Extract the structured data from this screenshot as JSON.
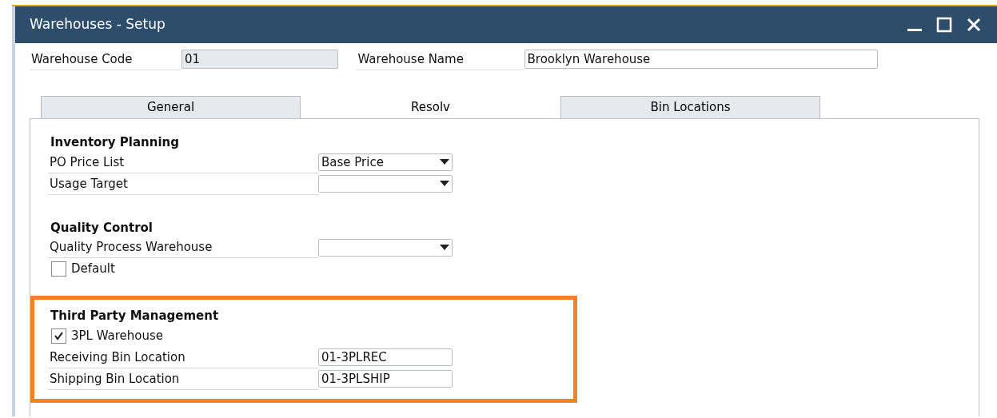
{
  "window": {
    "title": "Warehouses - Setup"
  },
  "header": [
    {
      "label": "Warehouse Code",
      "value": "01",
      "disabled": true
    },
    {
      "label": "Warehouse Name",
      "value": "Brooklyn Warehouse",
      "disabled": false
    }
  ],
  "tabs": [
    {
      "label": "General",
      "selected": false
    },
    {
      "label": "Resolv",
      "selected": true
    },
    {
      "label": "Bin Locations",
      "selected": false
    }
  ],
  "sections": [
    {
      "title": "Inventory Planning",
      "highlighted": false,
      "rows": [
        {
          "kind": "dropdown",
          "label": "PO Price List",
          "value": "Base Price"
        },
        {
          "kind": "dropdown",
          "label": "Usage Target"
        }
      ]
    },
    {
      "title": "Quality Control",
      "highlighted": false,
      "rows": [
        {
          "kind": "dropdown",
          "label": "Quality Process Warehouse"
        },
        {
          "kind": "checkbox",
          "label": "Default",
          "checked": false
        }
      ]
    },
    {
      "title": "Third Party Management",
      "highlighted": true,
      "rows": [
        {
          "kind": "checkbox",
          "label": "3PL Warehouse",
          "checked": true
        },
        {
          "kind": "text",
          "label": "Receiving Bin Location",
          "value": "01-3PLREC"
        },
        {
          "kind": "text",
          "label": "Shipping Bin Location",
          "value": "01-3PLSHIP"
        }
      ]
    }
  ]
}
